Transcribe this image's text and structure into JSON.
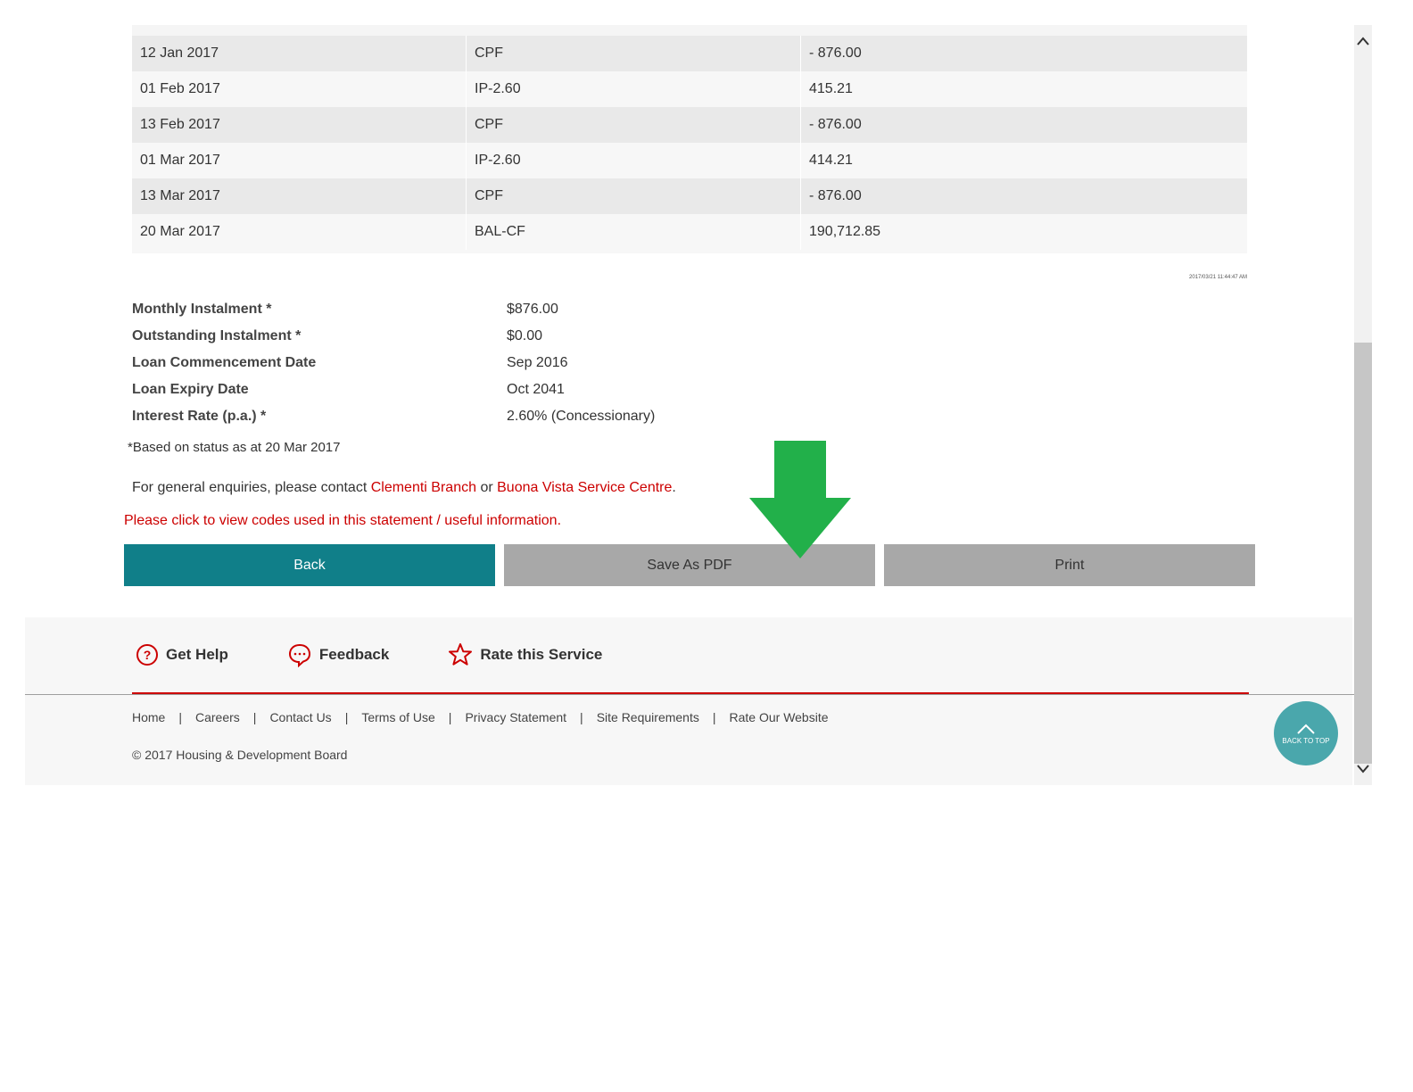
{
  "transactions": {
    "rows": [
      {
        "date": "12 Jan 2017",
        "code": "CPF",
        "amount": "- 876.00"
      },
      {
        "date": "01 Feb 2017",
        "code": "IP-2.60",
        "amount": "415.21"
      },
      {
        "date": "13 Feb 2017",
        "code": "CPF",
        "amount": "- 876.00"
      },
      {
        "date": "01 Mar 2017",
        "code": "IP-2.60",
        "amount": "414.21"
      },
      {
        "date": "13 Mar 2017",
        "code": "CPF",
        "amount": "- 876.00"
      },
      {
        "date": "20 Mar 2017",
        "code": "BAL-CF",
        "amount": "190,712.85"
      }
    ]
  },
  "timestamp": "2017/03/21 11:44:47 AM",
  "summary": [
    {
      "label": "Monthly Instalment *",
      "value": "$876.00"
    },
    {
      "label": "Outstanding Instalment *",
      "value": "$0.00"
    },
    {
      "label": "Loan Commencement Date",
      "value": "Sep 2016"
    },
    {
      "label": "Loan Expiry Date",
      "value": "Oct 2041"
    },
    {
      "label": "Interest Rate (p.a.) *",
      "value": "2.60% (Concessionary)"
    }
  ],
  "note": "*Based on status as at 20 Mar 2017",
  "enquiry": {
    "prefix": "For general enquiries, please contact ",
    "link1": "Clementi Branch",
    "middle": " or ",
    "link2": "Buona Vista Service Centre",
    "suffix": "."
  },
  "codes_link": "Please click to view codes used in this statement / useful information.",
  "buttons": {
    "back": "Back",
    "save_pdf": "Save As PDF",
    "print": "Print"
  },
  "help_bar": {
    "get_help": "Get Help",
    "feedback": "Feedback",
    "rate_service": "Rate this Service"
  },
  "footer_links": [
    "Home",
    "Careers",
    "Contact Us",
    "Terms of Use",
    "Privacy Statement",
    "Site Requirements",
    "Rate Our Website"
  ],
  "copyright": "© 2017 Housing & Development Board",
  "back_to_top": "BACK TO TOP",
  "colors": {
    "teal": "#107f89",
    "red": "#cc0000",
    "arrow_green": "#22b04a",
    "back_to_top": "#4aa7ac"
  }
}
